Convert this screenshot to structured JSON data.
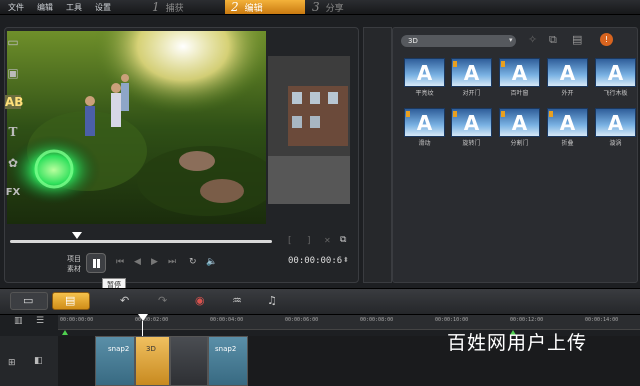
{
  "menu": {
    "file": "文件",
    "edit": "编辑",
    "tools": "工具",
    "settings": "设置"
  },
  "steps": [
    {
      "num": "1",
      "label": "捕获"
    },
    {
      "num": "2",
      "label": "编辑"
    },
    {
      "num": "3",
      "label": "分享"
    }
  ],
  "player": {
    "mode_project": "项目",
    "mode_clip": "素材",
    "timecode": "00:00:00:6",
    "tooltip": "暂停"
  },
  "library": {
    "dropdown": "3D",
    "thumbnails": [
      {
        "glyph": "A",
        "label": "平亮纹"
      },
      {
        "glyph": "A",
        "label": "对开门"
      },
      {
        "glyph": "A",
        "label": "百叶窗"
      },
      {
        "glyph": "A",
        "label": "外开"
      },
      {
        "glyph": "A",
        "label": "飞行木板"
      },
      {
        "glyph": "A",
        "label": "滑动"
      },
      {
        "glyph": "A",
        "label": "旋转门"
      },
      {
        "glyph": "A",
        "label": "分割门"
      },
      {
        "glyph": "A",
        "label": "折叠"
      },
      {
        "glyph": "A",
        "label": "漩涡"
      }
    ],
    "side_icons": [
      "FX"
    ]
  },
  "timeline": {
    "ruler_ticks": [
      "00:00:00:00",
      "00:00:02:00",
      "00:00:04:00",
      "00:00:06:00",
      "00:00:08:00",
      "00:00:10:00",
      "00:00:12:00",
      "00:00:14:00"
    ],
    "clips": [
      {
        "label": "snap2"
      },
      {
        "label": "3D"
      },
      {
        "label": "snap2"
      }
    ]
  },
  "watermark": "百姓网用户上传",
  "colors": {
    "accent": "#f3b23a",
    "panel": "#2a2c30",
    "background": "#1d1f22"
  }
}
